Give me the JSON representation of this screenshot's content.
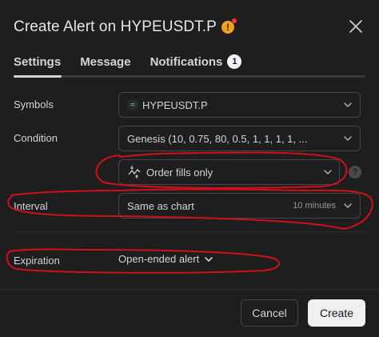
{
  "dialog": {
    "title": "Create Alert on HYPEUSDT.P",
    "warning_icon": "warning-icon",
    "close_icon": "close-icon"
  },
  "tabs": [
    {
      "label": "Settings",
      "active": true
    },
    {
      "label": "Message",
      "active": false
    },
    {
      "label": "Notifications",
      "active": false,
      "badge": "1"
    }
  ],
  "form": {
    "symbols": {
      "label": "Symbols",
      "value": "HYPEUSDT.P",
      "icon": "hype-logo-icon"
    },
    "condition": {
      "label": "Condition",
      "value": "Genesis (10, 0.75, 80, 0.5, 1, 1, 1, 1, ..."
    },
    "order_fills": {
      "value": "Order fills only",
      "icon": "order-fills-icon",
      "help_icon": "question-icon"
    },
    "interval": {
      "label": "Interval",
      "value": "Same as chart",
      "hint": "10 minutes"
    },
    "expiration": {
      "label": "Expiration",
      "value": "Open-ended alert"
    }
  },
  "footer": {
    "cancel_label": "Cancel",
    "create_label": "Create"
  },
  "colors": {
    "background": "#1e1e1e",
    "annotation": "#d0101a",
    "warning": "#f0a31a",
    "primary_button": "#f0f0f0"
  }
}
